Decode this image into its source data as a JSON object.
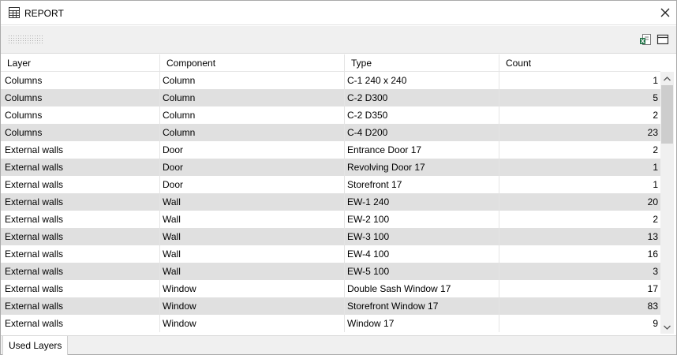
{
  "window": {
    "title": "REPORT"
  },
  "icons": {
    "title": "table-icon",
    "close": "close-icon",
    "grip": "toolbar-grip-icon",
    "export": "export-excel-icon",
    "view": "window-layout-icon",
    "scroll_up": "chevron-up-icon",
    "scroll_down": "chevron-down-icon"
  },
  "colors": {
    "alt_row": "#e0e0e0",
    "toolbar_bg": "#f0f0f0",
    "excel_green": "#1e7145"
  },
  "table": {
    "columns": [
      "Layer",
      "Component",
      "Type",
      "Count"
    ],
    "rows": [
      {
        "layer": "Columns",
        "component": "Column",
        "type": "C-1 240 x 240",
        "count": "1"
      },
      {
        "layer": "Columns",
        "component": "Column",
        "type": "C-2 D300",
        "count": "5"
      },
      {
        "layer": "Columns",
        "component": "Column",
        "type": "C-2 D350",
        "count": "2"
      },
      {
        "layer": "Columns",
        "component": "Column",
        "type": "C-4 D200",
        "count": "23"
      },
      {
        "layer": "External walls",
        "component": "Door",
        "type": "Entrance Door 17",
        "count": "2"
      },
      {
        "layer": "External walls",
        "component": "Door",
        "type": "Revolving Door 17",
        "count": "1"
      },
      {
        "layer": "External walls",
        "component": "Door",
        "type": "Storefront 17",
        "count": "1"
      },
      {
        "layer": "External walls",
        "component": "Wall",
        "type": "EW-1 240",
        "count": "20"
      },
      {
        "layer": "External walls",
        "component": "Wall",
        "type": "EW-2 100",
        "count": "2"
      },
      {
        "layer": "External walls",
        "component": "Wall",
        "type": "EW-3 100",
        "count": "13"
      },
      {
        "layer": "External walls",
        "component": "Wall",
        "type": "EW-4 100",
        "count": "16"
      },
      {
        "layer": "External walls",
        "component": "Wall",
        "type": "EW-5 100",
        "count": "3"
      },
      {
        "layer": "External walls",
        "component": "Window",
        "type": "Double Sash Window 17",
        "count": "17"
      },
      {
        "layer": "External walls",
        "component": "Window",
        "type": "Storefront Window 17",
        "count": "83"
      },
      {
        "layer": "External walls",
        "component": "Window",
        "type": "Window 17",
        "count": "9"
      }
    ]
  },
  "status": {
    "tab_label": "Used Layers"
  }
}
